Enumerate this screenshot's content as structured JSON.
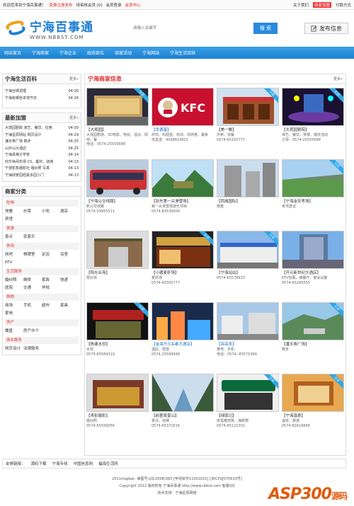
{
  "topbar": {
    "welcome": "欢迎您来到宁海百事通！",
    "register": "免费注册发布",
    "member": "待审核会员 [0]",
    "login": "会员登录",
    "center": "会员中心",
    "about": "关于我们",
    "ad": "商家加盟",
    "pay": "付款方式"
  },
  "brand": {
    "name": "宁海百事通",
    "url": "WWW.NBBST.COM"
  },
  "search": {
    "placeholder": "请输入关键字",
    "button": "搜 索",
    "publish": "发布信息"
  },
  "nav": [
    "网站首页",
    "宁海商家",
    "宁海企业",
    "政府部位",
    "商家活动",
    "宁海网站",
    "宁海生活百科"
  ],
  "sidebar": {
    "encyclopedia": {
      "title": "宁海生活百科",
      "more": "更多»",
      "items": [
        {
          "t": "宁海丝绸调理",
          "d": "04-26"
        },
        {
          "t": "宁海有哪些本地节日",
          "d": "04-26"
        }
      ]
    },
    "latest": {
      "title": "最新加盟",
      "more": "更多»",
      "items": [
        {
          "t": "大境园剧院 演艺、餐饮、住宿",
          "d": "04-30"
        },
        {
          "t": "宁海星辰网站 网页设计",
          "d": "04-29"
        },
        {
          "t": "潘天寿广场 数步",
          "d": "04-25"
        },
        {
          "t": "山外山大酒店",
          "d": "04-25"
        },
        {
          "t": "宁海县梯子学校",
          "d": "04-14"
        },
        {
          "t": "欣乐休闲农场 CS、垂钓、烧烤",
          "d": "04-13"
        },
        {
          "t": "宁波影象摄影社 婚纱照 写真",
          "d": "04-13"
        },
        {
          "t": "宁海绿景园纽豪多园小门",
          "d": "04-13"
        }
      ]
    },
    "categories": {
      "title": "商家分类",
      "groups": [
        {
          "name": "吃喝",
          "items": [
            "快餐",
            "炒菜",
            "小吃",
            "酒店",
            "宾馆"
          ]
        },
        {
          "name": "旅游",
          "items": [
            "景点",
            "农家乐"
          ]
        },
        {
          "name": "休闲",
          "items": [
            "网吧",
            "棋牌室",
            "足浴",
            "浴室",
            "KTV"
          ]
        },
        {
          "name": "生活服务",
          "items": [
            "婚纱照",
            "维修",
            "家政",
            "快递",
            "医院",
            "交通",
            "学校"
          ]
        },
        {
          "name": "购物",
          "items": [
            "商场",
            "手机",
            "超市",
            "家具",
            "家电"
          ]
        },
        {
          "name": "房产",
          "items": [
            "楼盘",
            "房产中介"
          ]
        },
        {
          "name": "商业服务",
          "items": [
            "网页设计",
            "法律服务"
          ]
        }
      ]
    }
  },
  "main": {
    "title": "宁海商家信息",
    "more": "更多»",
    "cert_label": "认证",
    "cards": [
      {
        "name": "【大观园】",
        "desc": "大观园剧场、3D电影、电玩、溜冰、网吧、餐",
        "phone": "电话：0574-25555688",
        "img": "theater",
        "cert": true,
        "hl": false
      },
      {
        "name": "【肯德基】",
        "desc": "炸鸡、鸡翅堡、鸡块、鸡肉卷、署条",
        "phone": "宅急送：4008823823",
        "img": "kfc",
        "cert": false,
        "hl": true
      },
      {
        "name": "【美一餐】",
        "desc": "外卖、快餐",
        "phone": "0574-65165777",
        "img": "restaurant",
        "cert": true,
        "hl": false
      },
      {
        "name": "【大观园剧院】",
        "desc": "演艺、餐饮、茶楼、婚庆活动",
        "phone": "订票：0574-25555688",
        "img": "stage",
        "cert": true,
        "hl": false
      },
      {
        "name": "【宁海公交线路】",
        "desc": "新公交线路",
        "phone": "0574-59955511",
        "img": "bus",
        "cert": false,
        "hl": false
      },
      {
        "name": "【浙东第一尖滑雪场】",
        "desc": "第一尖滑雪场游乐项目",
        "phone": "0574-83539004",
        "img": "mountain",
        "cert": false,
        "hl": false
      },
      {
        "name": "【西城国际】",
        "desc": "楼盘",
        "phone": "",
        "img": "building",
        "cert": false,
        "hl": false
      },
      {
        "name": "【宁海金安考场】",
        "desc": "考驾驶证",
        "phone": "",
        "img": "field",
        "cert": true,
        "hl": false
      },
      {
        "name": "【阳光名苑】",
        "desc": "限价房",
        "phone": "",
        "img": "gate",
        "cert": false,
        "hl": false
      },
      {
        "name": "【小猪麦虾场】",
        "desc": "麦虾场",
        "phone": "0574-65505777",
        "img": "shop",
        "cert": true,
        "hl": false
      },
      {
        "name": "【宁海站站】",
        "desc": "",
        "phone": "0574-65578933",
        "img": "station",
        "cert": true,
        "hl": false
      },
      {
        "name": "【开元新世纪大酒店】",
        "desc": "KTV包厢，西餐厅，宴会设宴",
        "phone": "0574-65265555",
        "img": "hotel",
        "cert": false,
        "hl": false
      },
      {
        "name": "【陈建水饺】",
        "desc": "水饺",
        "phone": "0574-65584319",
        "img": "dumpling",
        "cert": true,
        "hl": false
      },
      {
        "name": "【金海开元名都大酒店】",
        "desc": "酒店、宾馆",
        "phone": "0574-25599999",
        "img": "citynight",
        "cert": false,
        "hl": true
      },
      {
        "name": "【亮亮发】",
        "desc": "宽电、手机",
        "phone": "电话：0574--83571999",
        "img": "road",
        "cert": false,
        "hl": true
      },
      {
        "name": "【潘天寿广场】",
        "desc": "数步",
        "phone": "",
        "img": "plaza",
        "cert": true,
        "hl": false
      },
      {
        "name": "【青影摄影】",
        "desc": "婚纱照",
        "phone": "0574-65556056",
        "img": "studio",
        "cert": false,
        "hl": false
      },
      {
        "name": "【前童梁皇山】",
        "desc": "景点，烧烤",
        "phone": "0574-65371616",
        "img": "valley",
        "cert": false,
        "hl": false
      },
      {
        "name": "【绿南记】",
        "desc": "皮蛋瘦肉粥，海鲜粥",
        "phone": "0574-65121301",
        "img": "porridge",
        "cert": true,
        "hl": false
      },
      {
        "name": "【宁海温泉】",
        "desc": "温泉、旅游",
        "phone": "0574-81616666",
        "img": "spa",
        "cert": true,
        "hl": false
      }
    ]
  },
  "footer": {
    "links_label": "友情链接：",
    "links": [
      "源码下载",
      "宁海专线",
      "中国信息网",
      "福海生活网"
    ],
    "l1": "2011mapbar, 审图号:GS(2008)383 [甲测资字11002015] [京ICP证070610号]",
    "l2": "Copyright 2012 版权所有 宁海百事通 http://www.nbbst.com 客服QQ",
    "l3": "技术支持：宁海星辰网络",
    "watermark": "ASP300",
    "watermark2": "源码"
  }
}
